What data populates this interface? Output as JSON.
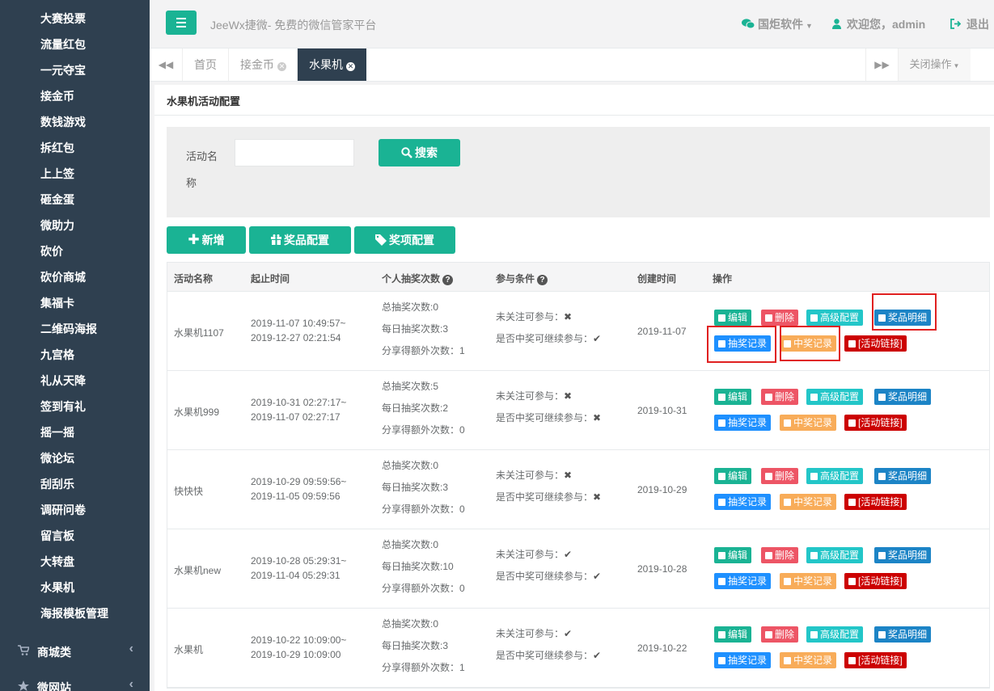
{
  "sidebar": {
    "items": [
      "大赛投票",
      "流量红包",
      "一元夺宝",
      "接金币",
      "数钱游戏",
      "拆红包",
      "上上签",
      "砸金蛋",
      "微助力",
      "砍价",
      "砍价商城",
      "集福卡",
      "二维码海报",
      "九宫格",
      "礼从天降",
      "签到有礼",
      "摇一摇",
      "微论坛",
      "刮刮乐",
      "调研问卷",
      "留言板",
      "大转盘",
      "水果机",
      "海报模板管理"
    ],
    "groups": [
      {
        "label": "商城类",
        "icon": "cart-icon"
      },
      {
        "label": "微网站",
        "icon": "star-icon"
      }
    ],
    "arrow": "‹"
  },
  "header": {
    "menu_icon": "bars-icon",
    "title": "JeeWx捷微- 免费的微信管家平台",
    "company": "国炬软件",
    "welcome": "欢迎您，admin",
    "logout": "退出",
    "accent": "#1ab394"
  },
  "tabs": {
    "prev": "◀◀",
    "next": "▶▶",
    "items": [
      {
        "label": "首页"
      },
      {
        "label": "接金币"
      },
      {
        "label": "水果机"
      }
    ],
    "close_ops": "关闭操作"
  },
  "panel": {
    "title": "水果机活动配置"
  },
  "search": {
    "label": "活动名称",
    "value": "",
    "button": "搜索"
  },
  "actions": {
    "add": "新增",
    "prize_config": "奖品配置",
    "award_config": "奖项配置"
  },
  "table": {
    "headers": [
      "活动名称",
      "起止时间",
      "个人抽奖次数",
      "参与条件",
      "创建时间",
      "操作"
    ],
    "help": "?",
    "buttons": {
      "edit": "编辑",
      "delete": "删除",
      "advanced": "高级配置",
      "prize_detail": "奖品明细",
      "draw_record": "抽奖记录",
      "win_record": "中奖记录",
      "activity_link": "[活动链接]"
    },
    "rows": [
      {
        "name": "水果机1107",
        "start": "2019-11-07 10:49:57~",
        "end": "2019-12-27 02:21:54",
        "total": "总抽奖次数:0",
        "daily": "每日抽奖次数:3",
        "share": "分享得额外次数：1",
        "cond1": "未关注可参与：",
        "cond1_mark": "✖",
        "cond2": "是否中奖可继续参与：",
        "cond2_mark": "✔",
        "created": "2019-11-07"
      },
      {
        "name": "水果机999",
        "start": "2019-10-31 02:27:17~",
        "end": "2019-11-07 02:27:17",
        "total": "总抽奖次数:5",
        "daily": "每日抽奖次数:2",
        "share": "分享得额外次数：0",
        "cond1": "未关注可参与：",
        "cond1_mark": "✖",
        "cond2": "是否中奖可继续参与：",
        "cond2_mark": "✖",
        "created": "2019-10-31"
      },
      {
        "name": "快快快",
        "start": "2019-10-29 09:59:56~",
        "end": "2019-11-05 09:59:56",
        "total": "总抽奖次数:0",
        "daily": "每日抽奖次数:3",
        "share": "分享得额外次数：0",
        "cond1": "未关注可参与：",
        "cond1_mark": "✖",
        "cond2": "是否中奖可继续参与：",
        "cond2_mark": "✖",
        "created": "2019-10-29"
      },
      {
        "name": "水果机new",
        "start": "2019-10-28 05:29:31~",
        "end": "2019-11-04 05:29:31",
        "total": "总抽奖次数:0",
        "daily": "每日抽奖次数:10",
        "share": "分享得额外次数：0",
        "cond1": "未关注可参与：",
        "cond1_mark": "✔",
        "cond2": "是否中奖可继续参与：",
        "cond2_mark": "✔",
        "created": "2019-10-28"
      },
      {
        "name": "水果机",
        "start": "2019-10-22 10:09:00~",
        "end": "2019-10-29 10:09:00",
        "total": "总抽奖次数:0",
        "daily": "每日抽奖次数:3",
        "share": "分享得额外次数：1",
        "cond1": "未关注可参与：",
        "cond1_mark": "✔",
        "cond2": "是否中奖可继续参与：",
        "cond2_mark": "✔",
        "created": "2019-10-22"
      }
    ]
  },
  "highlight_color": "#e02020"
}
